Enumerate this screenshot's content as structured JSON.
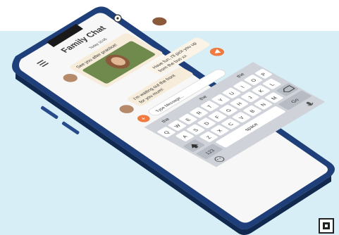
{
  "chat": {
    "title": "Family Chat",
    "date_label": "Today 15:05",
    "messages": [
      {
        "from": "contact",
        "text": "See you after practice!"
      },
      {
        "from": "user",
        "line1": "Have fun, I'll pick you up",
        "line2": "from the bus xx"
      },
      {
        "from": "contact",
        "line1": "I'm waiting out the front",
        "line2": "for you mum!"
      }
    ],
    "input_placeholder": "Type Message..."
  },
  "keyboard": {
    "suggestions": [
      "the",
      "the",
      "the"
    ],
    "row1": [
      "Q",
      "W",
      "E",
      "R",
      "T",
      "Y",
      "U",
      "I",
      "O",
      "P"
    ],
    "row2": [
      "A",
      "S",
      "D",
      "F",
      "G",
      "H",
      "J",
      "K",
      "L"
    ],
    "row3": [
      "Z",
      "X",
      "C",
      "V",
      "B",
      "N",
      "M"
    ],
    "numbers_label": "123",
    "space_label": "space",
    "go_label": "Go"
  },
  "colors": {
    "backdrop": "#d7eef7",
    "phone_frame": "#1f3f7a",
    "accent_orange": "#f07a3f",
    "bubble_contact": "#f6ecd9",
    "bubble_user": "#fbf4e6",
    "keyboard_bg": "#cfd3d9"
  },
  "icons": [
    "menu-icon",
    "contact-avatar-icon",
    "user-avatar-icon",
    "send-icon",
    "add-icon",
    "mic-icon",
    "emoji-icon",
    "shift-icon",
    "backspace-icon",
    "camera-icon",
    "qr-code-icon"
  ]
}
